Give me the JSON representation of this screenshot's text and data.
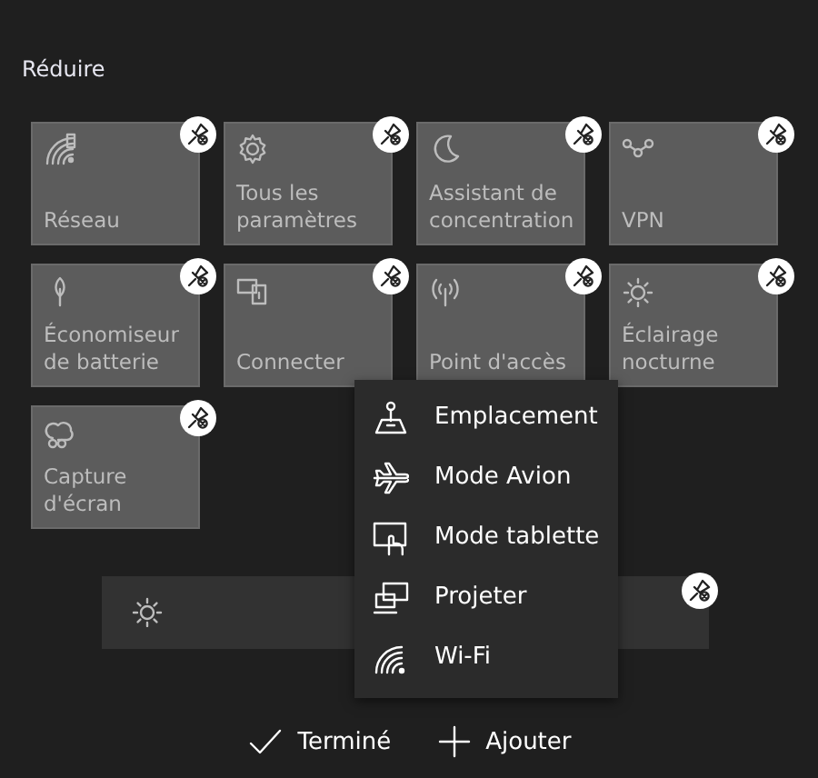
{
  "header": {
    "title": "Réduire"
  },
  "tiles": [
    {
      "label": "Réseau"
    },
    {
      "label": "Tous les paramètres"
    },
    {
      "label": "Assistant de concentration"
    },
    {
      "label": "VPN"
    },
    {
      "label": "Économiseur de batterie"
    },
    {
      "label": "Connecter"
    },
    {
      "label": "Point d'accès"
    },
    {
      "label": "Éclairage nocturne"
    },
    {
      "label": "Capture d'écran"
    }
  ],
  "add_menu": {
    "items": [
      {
        "label": "Emplacement"
      },
      {
        "label": "Mode Avion"
      },
      {
        "label": "Mode tablette"
      },
      {
        "label": "Projeter"
      },
      {
        "label": "Wi-Fi"
      }
    ]
  },
  "footer": {
    "done": "Terminé",
    "add": "Ajouter"
  }
}
